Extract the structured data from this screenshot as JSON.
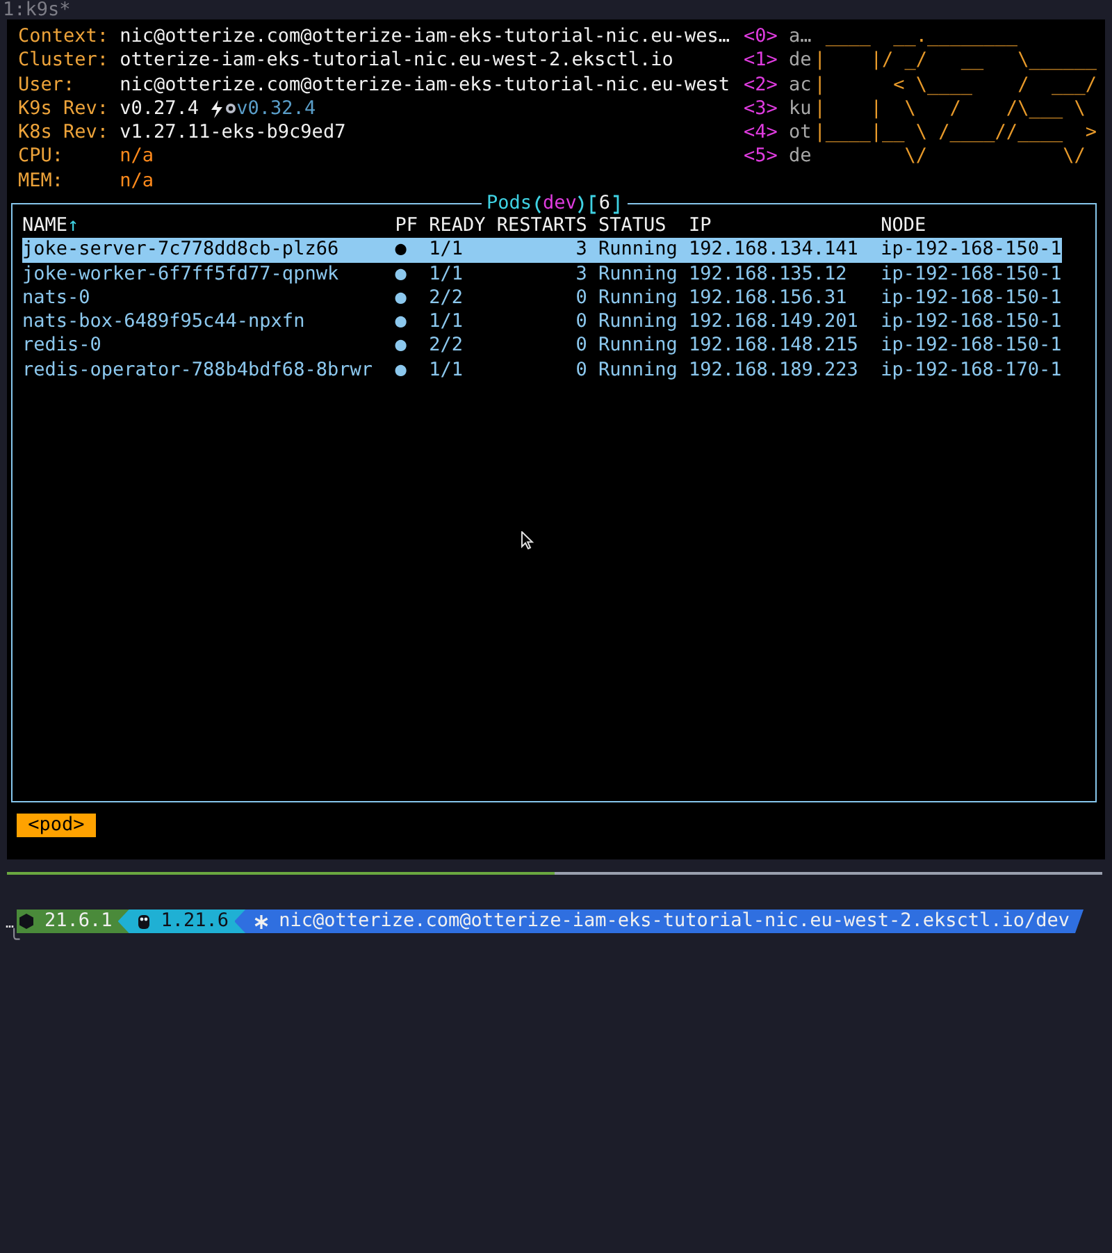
{
  "tab_title": "1:k9s*",
  "header": {
    "fields": [
      {
        "label": "Context:",
        "value": "nic@otterize.com@otterize-iam-eks-tutorial-nic.eu-wes…",
        "kind": "info"
      },
      {
        "label": "Cluster:",
        "value": "otterize-iam-eks-tutorial-nic.eu-west-2.eksctl.io",
        "kind": "info"
      },
      {
        "label": "User:",
        "value": "nic@otterize.com@otterize-iam-eks-tutorial-nic.eu-west",
        "kind": "info"
      },
      {
        "label": "K9s Rev:",
        "value": "v0.27.4",
        "kind": "version",
        "upgrade": "v0.32.4"
      },
      {
        "label": "K8s Rev:",
        "value": "v1.27.11-eks-b9c9ed7",
        "kind": "info"
      },
      {
        "label": "CPU:",
        "value": "n/a",
        "kind": "metric"
      },
      {
        "label": "MEM:",
        "value": "n/a",
        "kind": "metric"
      }
    ],
    "shortcuts": [
      {
        "key": "<0>",
        "label": "a…"
      },
      {
        "key": "<1>",
        "label": "de"
      },
      {
        "key": "<2>",
        "label": "ac"
      },
      {
        "key": "<3>",
        "label": "ku"
      },
      {
        "key": "<4>",
        "label": "ot"
      },
      {
        "key": "<5>",
        "label": "de"
      }
    ],
    "logo_lines": [
      " ____  __.________",
      "|    |/ _/   __   \\______",
      "|      < \\____    /  ___/",
      "|    |  \\   /    /\\___ \\",
      "|____|__ \\ /____//____  >",
      "        \\/            \\/"
    ]
  },
  "pods": {
    "title": "Pods",
    "namespace": "dev",
    "count": "6",
    "columns": [
      {
        "label": "NAME",
        "sort": "↑"
      },
      {
        "label": "PF"
      },
      {
        "label": "READY"
      },
      {
        "label": "RESTARTS"
      },
      {
        "label": "STATUS"
      },
      {
        "label": "IP"
      },
      {
        "label": "NODE"
      }
    ],
    "rows": [
      {
        "name": "joke-server-7c778dd8cb-plz66",
        "pf": "●",
        "ready": "1/1",
        "restarts": "3",
        "status": "Running",
        "ip": "192.168.134.141",
        "node": "ip-192-168-150-1",
        "selected": true
      },
      {
        "name": "joke-worker-6f7ff5fd77-qpnwk",
        "pf": "●",
        "ready": "1/1",
        "restarts": "3",
        "status": "Running",
        "ip": "192.168.135.12",
        "node": "ip-192-168-150-1",
        "selected": false
      },
      {
        "name": "nats-0",
        "pf": "●",
        "ready": "2/2",
        "restarts": "0",
        "status": "Running",
        "ip": "192.168.156.31",
        "node": "ip-192-168-150-1",
        "selected": false
      },
      {
        "name": "nats-box-6489f95c44-npxfn",
        "pf": "●",
        "ready": "1/1",
        "restarts": "0",
        "status": "Running",
        "ip": "192.168.149.201",
        "node": "ip-192-168-150-1",
        "selected": false
      },
      {
        "name": "redis-0",
        "pf": "●",
        "ready": "2/2",
        "restarts": "0",
        "status": "Running",
        "ip": "192.168.148.215",
        "node": "ip-192-168-150-1",
        "selected": false
      },
      {
        "name": "redis-operator-788b4bdf68-8brwr",
        "pf": "●",
        "ready": "1/1",
        "restarts": "0",
        "status": "Running",
        "ip": "192.168.189.223",
        "node": "ip-192-168-170-1",
        "selected": false
      }
    ]
  },
  "crumbs": [
    "<pod>"
  ],
  "divider": {
    "level": 0.5
  },
  "prompt": {
    "ellipsis": "…",
    "segments": [
      {
        "kind": "node",
        "text": "21.6.1"
      },
      {
        "kind": "go",
        "text": "1.21.6"
      },
      {
        "kind": "kube",
        "text": "nic@otterize.com@otterize-iam-eks-tutorial-nic.eu-west-2.eksctl.io/dev"
      }
    ],
    "corner": "╰"
  }
}
